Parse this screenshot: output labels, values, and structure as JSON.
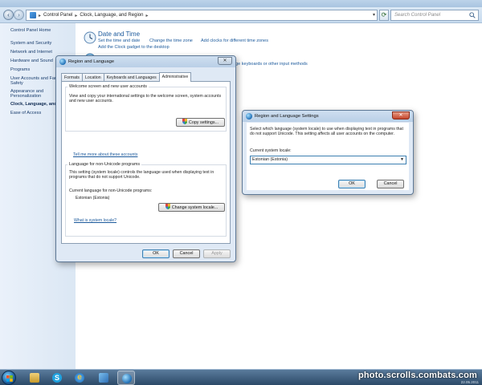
{
  "explorer": {
    "breadcrumb": [
      "Control Panel",
      "Clock, Language, and Region"
    ],
    "search_placeholder": "Search Control Panel"
  },
  "left_nav": {
    "items": [
      {
        "label": "Control Panel Home",
        "current": false
      },
      {
        "label": "System and Security",
        "current": false
      },
      {
        "label": "Network and Internet",
        "current": false
      },
      {
        "label": "Hardware and Sound",
        "current": false
      },
      {
        "label": "Programs",
        "current": false
      },
      {
        "label": "User Accounts and Family Safety",
        "current": false
      },
      {
        "label": "Appearance and Personalization",
        "current": false
      },
      {
        "label": "Clock, Language, and Region",
        "current": true
      },
      {
        "label": "Ease of Access",
        "current": false
      }
    ],
    "user_accounts_line1": "User Accounts and Fam",
    "user_accounts_line2": "Safety",
    "appearance_line1": "Appearance and",
    "appearance_line2": "Personalization",
    "clock_truncated": "Clock, Language, and R"
  },
  "content": {
    "date_time": {
      "title": "Date and Time",
      "links": [
        "Set the time and date",
        "Change the time zone",
        "Add clocks for different time zones",
        "Add the Clock gadget to the desktop"
      ]
    },
    "region_partial_link": "ange keyboards or other input methods"
  },
  "region_dialog": {
    "title": "Region and Language",
    "tabs": [
      {
        "label": "Formats",
        "active": false
      },
      {
        "label": "Location",
        "active": false
      },
      {
        "label": "Keyboards and Languages",
        "active": false
      },
      {
        "label": "Administrative",
        "active": true
      }
    ],
    "welcome_group": {
      "label": "Welcome screen and new user accounts",
      "text": "View and copy your international settings to the welcome screen, system accounts and new user accounts.",
      "button": "Copy settings..."
    },
    "tell_me_link": "Tell me more about these accounts",
    "non_unicode_group": {
      "label": "Language for non-Unicode programs",
      "text": "This setting (system locale) controls the language used when displaying text in programs that do not support Unicode.",
      "current_label": "Current language for non-Unicode programs:",
      "current_value": "Estonian (Estonia)",
      "button": "Change system locale..."
    },
    "locale_link": "What is system locale?",
    "ok": "OK",
    "cancel": "Cancel",
    "apply": "Apply"
  },
  "settings_dialog": {
    "title": "Region and Language Settings",
    "description": "Select which language (system locale) to use when displaying text in programs that do not support Unicode. This setting affects all user accounts on the computer.",
    "current_label": "Current system locale:",
    "selected_locale": "Estonian (Estonia)",
    "ok": "OK",
    "cancel": "Cancel"
  },
  "taskbar": {
    "items": [
      "explorer",
      "skype",
      "internet-explorer",
      "control-panel",
      "region-and-language"
    ],
    "watermark": "photo.scrolls.combats.com",
    "watermark_date": "22.05.2011"
  },
  "colors": {
    "link": "#1c5a9c",
    "left_pane": "#dbe7f4",
    "dialog_bg": "#dfe9f5",
    "close_red": "#c4442a",
    "taskbar": "#2c4a68"
  }
}
